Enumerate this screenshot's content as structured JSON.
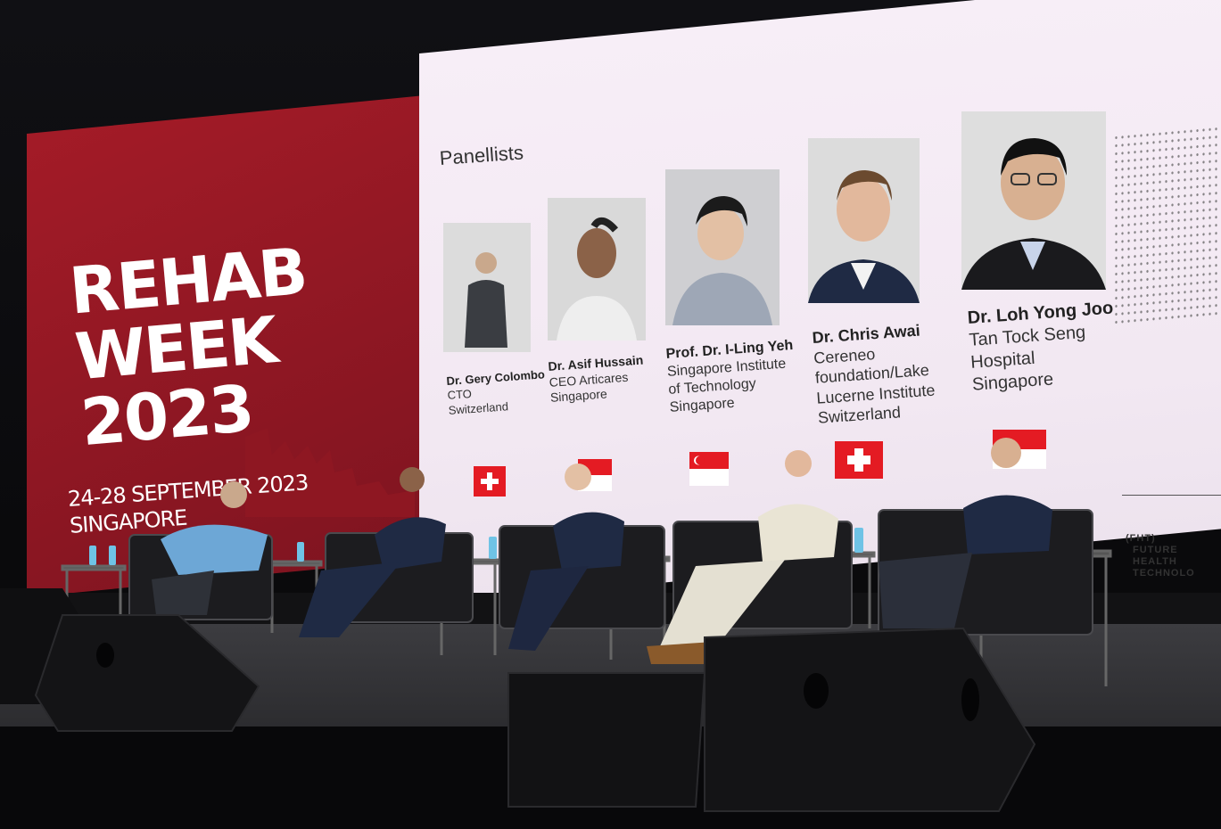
{
  "event": {
    "title": "REHAB\nWEEK\n2023",
    "dates": "24-28 SEPTEMBER 2023",
    "location": "SINGAPORE",
    "brand_color": "#a31b27"
  },
  "screen": {
    "heading": "Panellists",
    "footer_logo_abbr": "(FHT)",
    "footer_logo_text": [
      "FUTURE",
      "HEALTH",
      "TECHNOLO"
    ]
  },
  "panellists": [
    {
      "name": "Dr. Gery Colombo",
      "lines": [
        "CTO",
        "Switzerland"
      ],
      "flag": "switzerland-flag"
    },
    {
      "name": "Dr. Asif Hussain",
      "lines": [
        "CEO Articares",
        "Singapore"
      ],
      "flag": "singapore-flag"
    },
    {
      "name": "Prof. Dr. I-Ling Yeh",
      "lines": [
        "Singapore Institute",
        "of Technology",
        "Singapore"
      ],
      "flag": "singapore-flag"
    },
    {
      "name": "Dr. Chris Awai",
      "lines": [
        "Cereneo",
        "foundation/Lake",
        "Lucerne Institute",
        "Switzerland"
      ],
      "flag": "switzerland-flag"
    },
    {
      "name": "Dr. Loh Yong Joo",
      "lines": [
        "Tan Tock Seng",
        "Hospital",
        "Singapore"
      ],
      "flag": "singapore-flag"
    }
  ]
}
